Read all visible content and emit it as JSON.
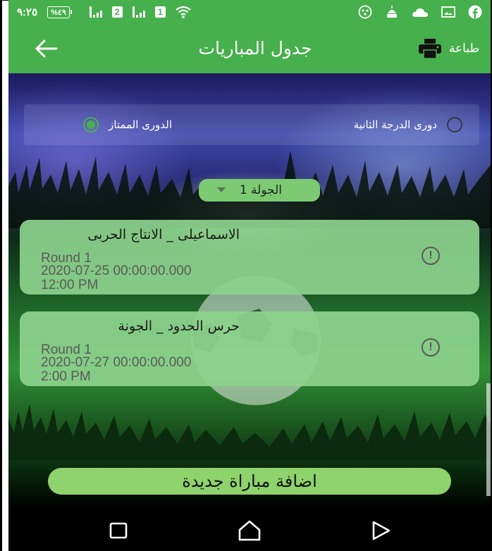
{
  "status_bar": {
    "time": "٩:٢٥",
    "battery": "%٤٩",
    "sim1": "2",
    "sim2": "1"
  },
  "app_bar": {
    "title": "جدول المباريات",
    "print_label": "طباعة"
  },
  "league_selector": {
    "options": [
      {
        "label": "دورى الدرجة الثانية",
        "selected": false
      },
      {
        "label": "الدورى الممتاز",
        "selected": true
      }
    ]
  },
  "round_dropdown": {
    "value": "الجولة 1"
  },
  "matches": [
    {
      "title": "الاسماعيلى _ الانتاج الحربى",
      "round": "Round 1",
      "date": "2020-07-25 00:00:00.000",
      "time": " 12:00 PM"
    },
    {
      "title": "حرس الحدود _ الجونة",
      "round": "Round 1",
      "date": "2020-07-27 00:00:00.000",
      "time": " 2:00 PM"
    }
  ],
  "add_button_label": "اضافة مباراة جديدة",
  "colors": {
    "primary": "#46b04c",
    "card": "#8cd28c",
    "button": "#8ed36c"
  },
  "icons": [
    "back-arrow-icon",
    "printer-icon",
    "info-icon",
    "wifi-icon",
    "facebook-icon",
    "cloud-icon",
    "gallery-icon",
    "mosque-icon",
    "game-icon"
  ]
}
